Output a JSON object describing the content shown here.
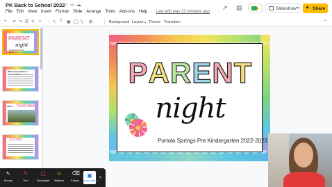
{
  "header": {
    "title": "PK Back to School 2022",
    "menu": [
      "File",
      "Edit",
      "View",
      "Insert",
      "Format",
      "Slide",
      "Arrange",
      "Tools",
      "Add-ons",
      "Help"
    ],
    "last_edit": "Last edit was 23 minutes ago",
    "slideshow_label": "Slideshow",
    "share_label": "Share"
  },
  "toolbar": {
    "background_label": "Background",
    "layout_label": "Layout",
    "theme_label": "Theme",
    "transition_label": "Transition"
  },
  "filmstrip": {
    "thumbs": [
      {
        "title": "PARENT",
        "night": "night",
        "sub": "Portola Springs Pre Kindergarten"
      },
      {
        "title": "Welcome to Back to School 2022"
      },
      {
        "title": "TEACHER",
        "left": "Meet"
      },
      {
        "title": "COVID"
      }
    ]
  },
  "slide": {
    "title_letters": [
      "P",
      "A",
      "R",
      "E",
      "N",
      "T"
    ],
    "title_colors": [
      "#f3a7b4",
      "#f7e07d",
      "#b9e5a3",
      "#9ed7ec",
      "#f3a7b4",
      "#f7e07d"
    ],
    "night": "night",
    "subtitle": "Portola Springs Pre Kindergarten 2022-2023"
  },
  "overlay": {
    "tools": [
      {
        "label": "Mouse",
        "icon": "cursor-icon"
      },
      {
        "label": "Pen",
        "icon": "pen-icon"
      },
      {
        "label": "Rectangle",
        "icon": "rectangle-icon"
      },
      {
        "label": "Stickers",
        "icon": "sticker-icon"
      },
      {
        "label": "Eraser",
        "icon": "eraser-icon"
      },
      {
        "label": "STOP WEBCAM",
        "icon": "webcam-icon"
      }
    ]
  }
}
